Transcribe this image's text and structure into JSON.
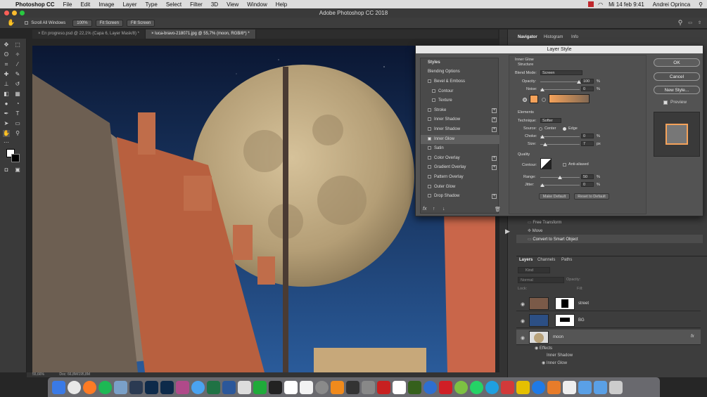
{
  "menubar": {
    "app": "Photoshop CC",
    "items": [
      "File",
      "Edit",
      "Image",
      "Layer",
      "Type",
      "Select",
      "Filter",
      "3D",
      "View",
      "Window",
      "Help"
    ],
    "clock": "Mi 14 feb  9:41",
    "user": "Andrei Oprinca"
  },
  "window": {
    "title": "Adobe Photoshop CC 2018"
  },
  "options": {
    "scroll_all": "Scroll All Windows",
    "zoom": "100%",
    "fit_screen": "Fit Screen",
    "fill_screen": "Fill Screen"
  },
  "doc_tabs": [
    "En progreso.psd @ 22,1% (Capa 6, Layer Mask/8) *",
    "luca-bravo-218071.jpg @ 55,7% (moon, RGB/8*) *"
  ],
  "status": {
    "zoom": "55,66%",
    "doc": "Doc: 66,8M/195,8M"
  },
  "dialog": {
    "title": "Layer Style",
    "styles_header": "Styles",
    "blending": "Blending Options",
    "items": [
      {
        "label": "Bevel & Emboss",
        "plus": false,
        "checked": false,
        "indent": false
      },
      {
        "label": "Contour",
        "plus": false,
        "checked": false,
        "indent": true
      },
      {
        "label": "Texture",
        "plus": false,
        "checked": false,
        "indent": true
      },
      {
        "label": "Stroke",
        "plus": true,
        "checked": false,
        "indent": false
      },
      {
        "label": "Inner Shadow",
        "plus": true,
        "checked": false,
        "indent": false
      },
      {
        "label": "Inner Shadow",
        "plus": true,
        "checked": false,
        "indent": false
      },
      {
        "label": "Inner Glow",
        "plus": false,
        "checked": true,
        "indent": false
      },
      {
        "label": "Satin",
        "plus": false,
        "checked": false,
        "indent": false
      },
      {
        "label": "Color Overlay",
        "plus": true,
        "checked": false,
        "indent": false
      },
      {
        "label": "Gradient Overlay",
        "plus": true,
        "checked": false,
        "indent": false
      },
      {
        "label": "Pattern Overlay",
        "plus": false,
        "checked": false,
        "indent": false
      },
      {
        "label": "Outer Glow",
        "plus": false,
        "checked": false,
        "indent": false
      },
      {
        "label": "Drop Shadow",
        "plus": true,
        "checked": false,
        "indent": false
      }
    ],
    "inner_glow": {
      "title": "Inner Glow",
      "structure": "Structure",
      "blend_mode_label": "Blend Mode:",
      "blend_mode": "Screen",
      "opacity_label": "Opacity:",
      "opacity": "100",
      "noise_label": "Noise:",
      "noise": "0",
      "elements": "Elements",
      "technique_label": "Technique:",
      "technique": "Softer",
      "source_label": "Source:",
      "source_center": "Center",
      "source_edge": "Edge",
      "choke_label": "Choke:",
      "choke": "0",
      "size_label": "Size:",
      "size": "7",
      "size_unit": "px",
      "quality": "Quality",
      "contour_label": "Contour:",
      "anti_aliased": "Anti-aliased",
      "range_label": "Range:",
      "range": "50",
      "jitter_label": "Jitter:",
      "jitter": "0",
      "percent": "%",
      "make_default": "Make Default",
      "reset_default": "Reset to Default",
      "glow_color": "#f5a25a"
    },
    "ok": "OK",
    "cancel": "Cancel",
    "new_style": "New Style...",
    "preview": "Preview"
  },
  "right_panel": {
    "tabs": [
      "Navigator",
      "Histogram",
      "Info"
    ],
    "history": [
      "Free Transform",
      "Move",
      "Convert to Smart Object"
    ],
    "layer_tabs": [
      "Layers",
      "Channels",
      "Paths"
    ],
    "kind": "Kind",
    "mode": "Normal",
    "opacity": "Opacity:",
    "lock": "Lock:",
    "fill": "Fill:",
    "layers": [
      {
        "name": "street"
      },
      {
        "name": "BG"
      },
      {
        "name": "moon"
      }
    ],
    "effects": "Effects",
    "effect_items": [
      "Inner Shadow",
      "Inner Glow"
    ]
  }
}
